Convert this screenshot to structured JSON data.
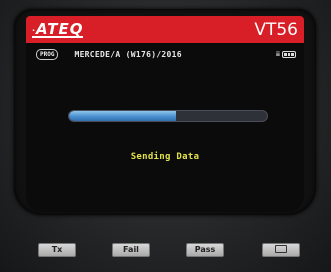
{
  "header": {
    "brand": "ATEQ",
    "model": "VT56"
  },
  "info": {
    "mode_badge": "PROG",
    "vehicle": "MERCEDE/A (W176)/2016",
    "battery_icon": "battery-icon"
  },
  "progress": {
    "value": 0.54,
    "fill_color": "#4a8fcf"
  },
  "status": {
    "message": "Sending Data"
  },
  "softkeys": {
    "tx": "Tx",
    "fail": "Fail",
    "pass": "Pass",
    "esc_icon": "escape-icon"
  },
  "colors": {
    "title_bar": "#d81e26",
    "status_text": "#e2e24a"
  }
}
